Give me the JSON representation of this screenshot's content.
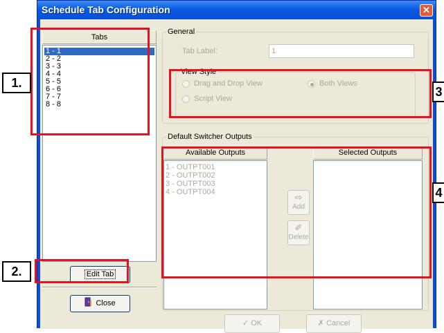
{
  "window": {
    "title": "Schedule Tab Configuration",
    "close_glyph": "✕"
  },
  "tabs_panel": {
    "header": "Tabs",
    "items": [
      "1 - 1",
      "2 - 2",
      "3 - 3",
      "4 - 4",
      "5 - 5",
      "6 - 6",
      "7 - 7",
      "8 - 8"
    ],
    "selected_index": 0,
    "edit_button": "Edit Tab",
    "close_button": "Close",
    "close_icon": "door-exit-icon"
  },
  "general": {
    "legend": "General",
    "tab_label_label": "Tab Label:",
    "tab_label_value": "1",
    "view_style": {
      "legend": "View Style",
      "options": [
        "Drag and Drop View",
        "Both Views",
        "Script View"
      ],
      "selected": "Both Views"
    }
  },
  "switcher": {
    "legend": "Default Switcher Outputs",
    "available_header": "Available Outputs",
    "selected_header": "Selected Outputs",
    "available": [
      "1 - OUTPT001",
      "2 - OUTPT002",
      "3 - OUTPT003",
      "4 - OUTPT004"
    ],
    "selected": [],
    "add_button": "Add",
    "add_icon": "arrow-right-icon",
    "delete_button": "Delete",
    "delete_icon": "eraser-icon"
  },
  "dialog_buttons": {
    "ok": "OK",
    "ok_icon": "checkmark-icon",
    "cancel": "Cancel",
    "cancel_icon": "x-mark-icon"
  },
  "annotations": [
    "1.",
    "2.",
    "3",
    "4"
  ],
  "colors": {
    "annotation_red": "#e8121e",
    "selection_blue": "#316ac5",
    "titlebar_blue": "#0a4fd6"
  }
}
